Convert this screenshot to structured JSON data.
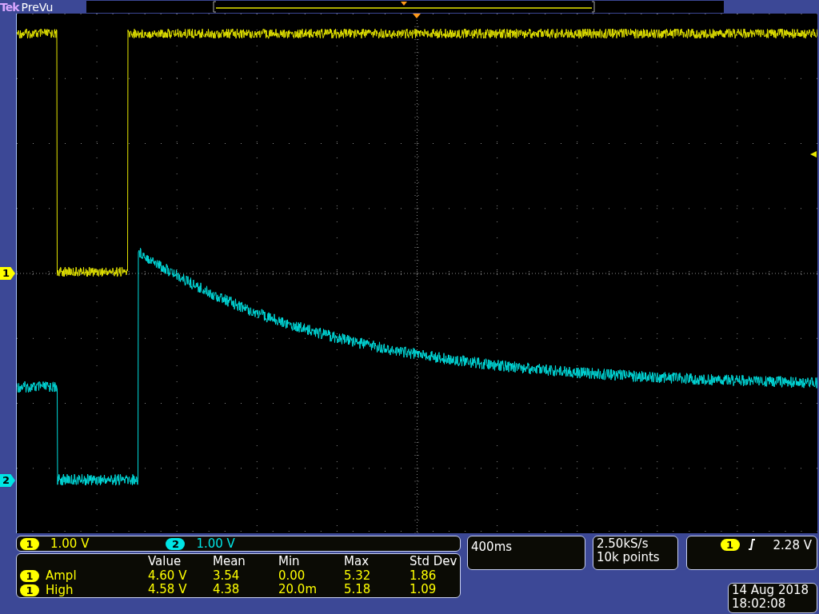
{
  "header": {
    "brand": "Tek",
    "mode": "PreVu"
  },
  "channel_markers": [
    {
      "label": "1",
      "color": "#ffff00"
    },
    {
      "label": "2",
      "color": "#00e5e5"
    }
  ],
  "scales": [
    {
      "channel": "1",
      "value": "1.00 V",
      "color": "#ffff00"
    },
    {
      "channel": "2",
      "value": "1.00 V",
      "color": "#00e5e5"
    }
  ],
  "measurements": {
    "columns": [
      "Value",
      "Mean",
      "Min",
      "Max",
      "Std Dev"
    ],
    "rows": [
      {
        "channel": "1",
        "color": "#ffff00",
        "name": "Ampl",
        "cells": [
          "4.60 V",
          "3.54",
          "0.00",
          "5.32",
          "1.86"
        ]
      },
      {
        "channel": "1",
        "color": "#ffff00",
        "name": "High",
        "cells": [
          "4.58 V",
          "4.38",
          "20.0m",
          "5.18",
          "1.09"
        ]
      }
    ]
  },
  "timebase": "400ms",
  "acquisition": {
    "sample_rate": "2.50kS/s",
    "record_length": "10k points"
  },
  "trigger": {
    "channel": "1",
    "color": "#ffff00",
    "level": "2.28 V"
  },
  "timestamp": {
    "date": "14 Aug 2018",
    "time": "18:02:08"
  }
}
